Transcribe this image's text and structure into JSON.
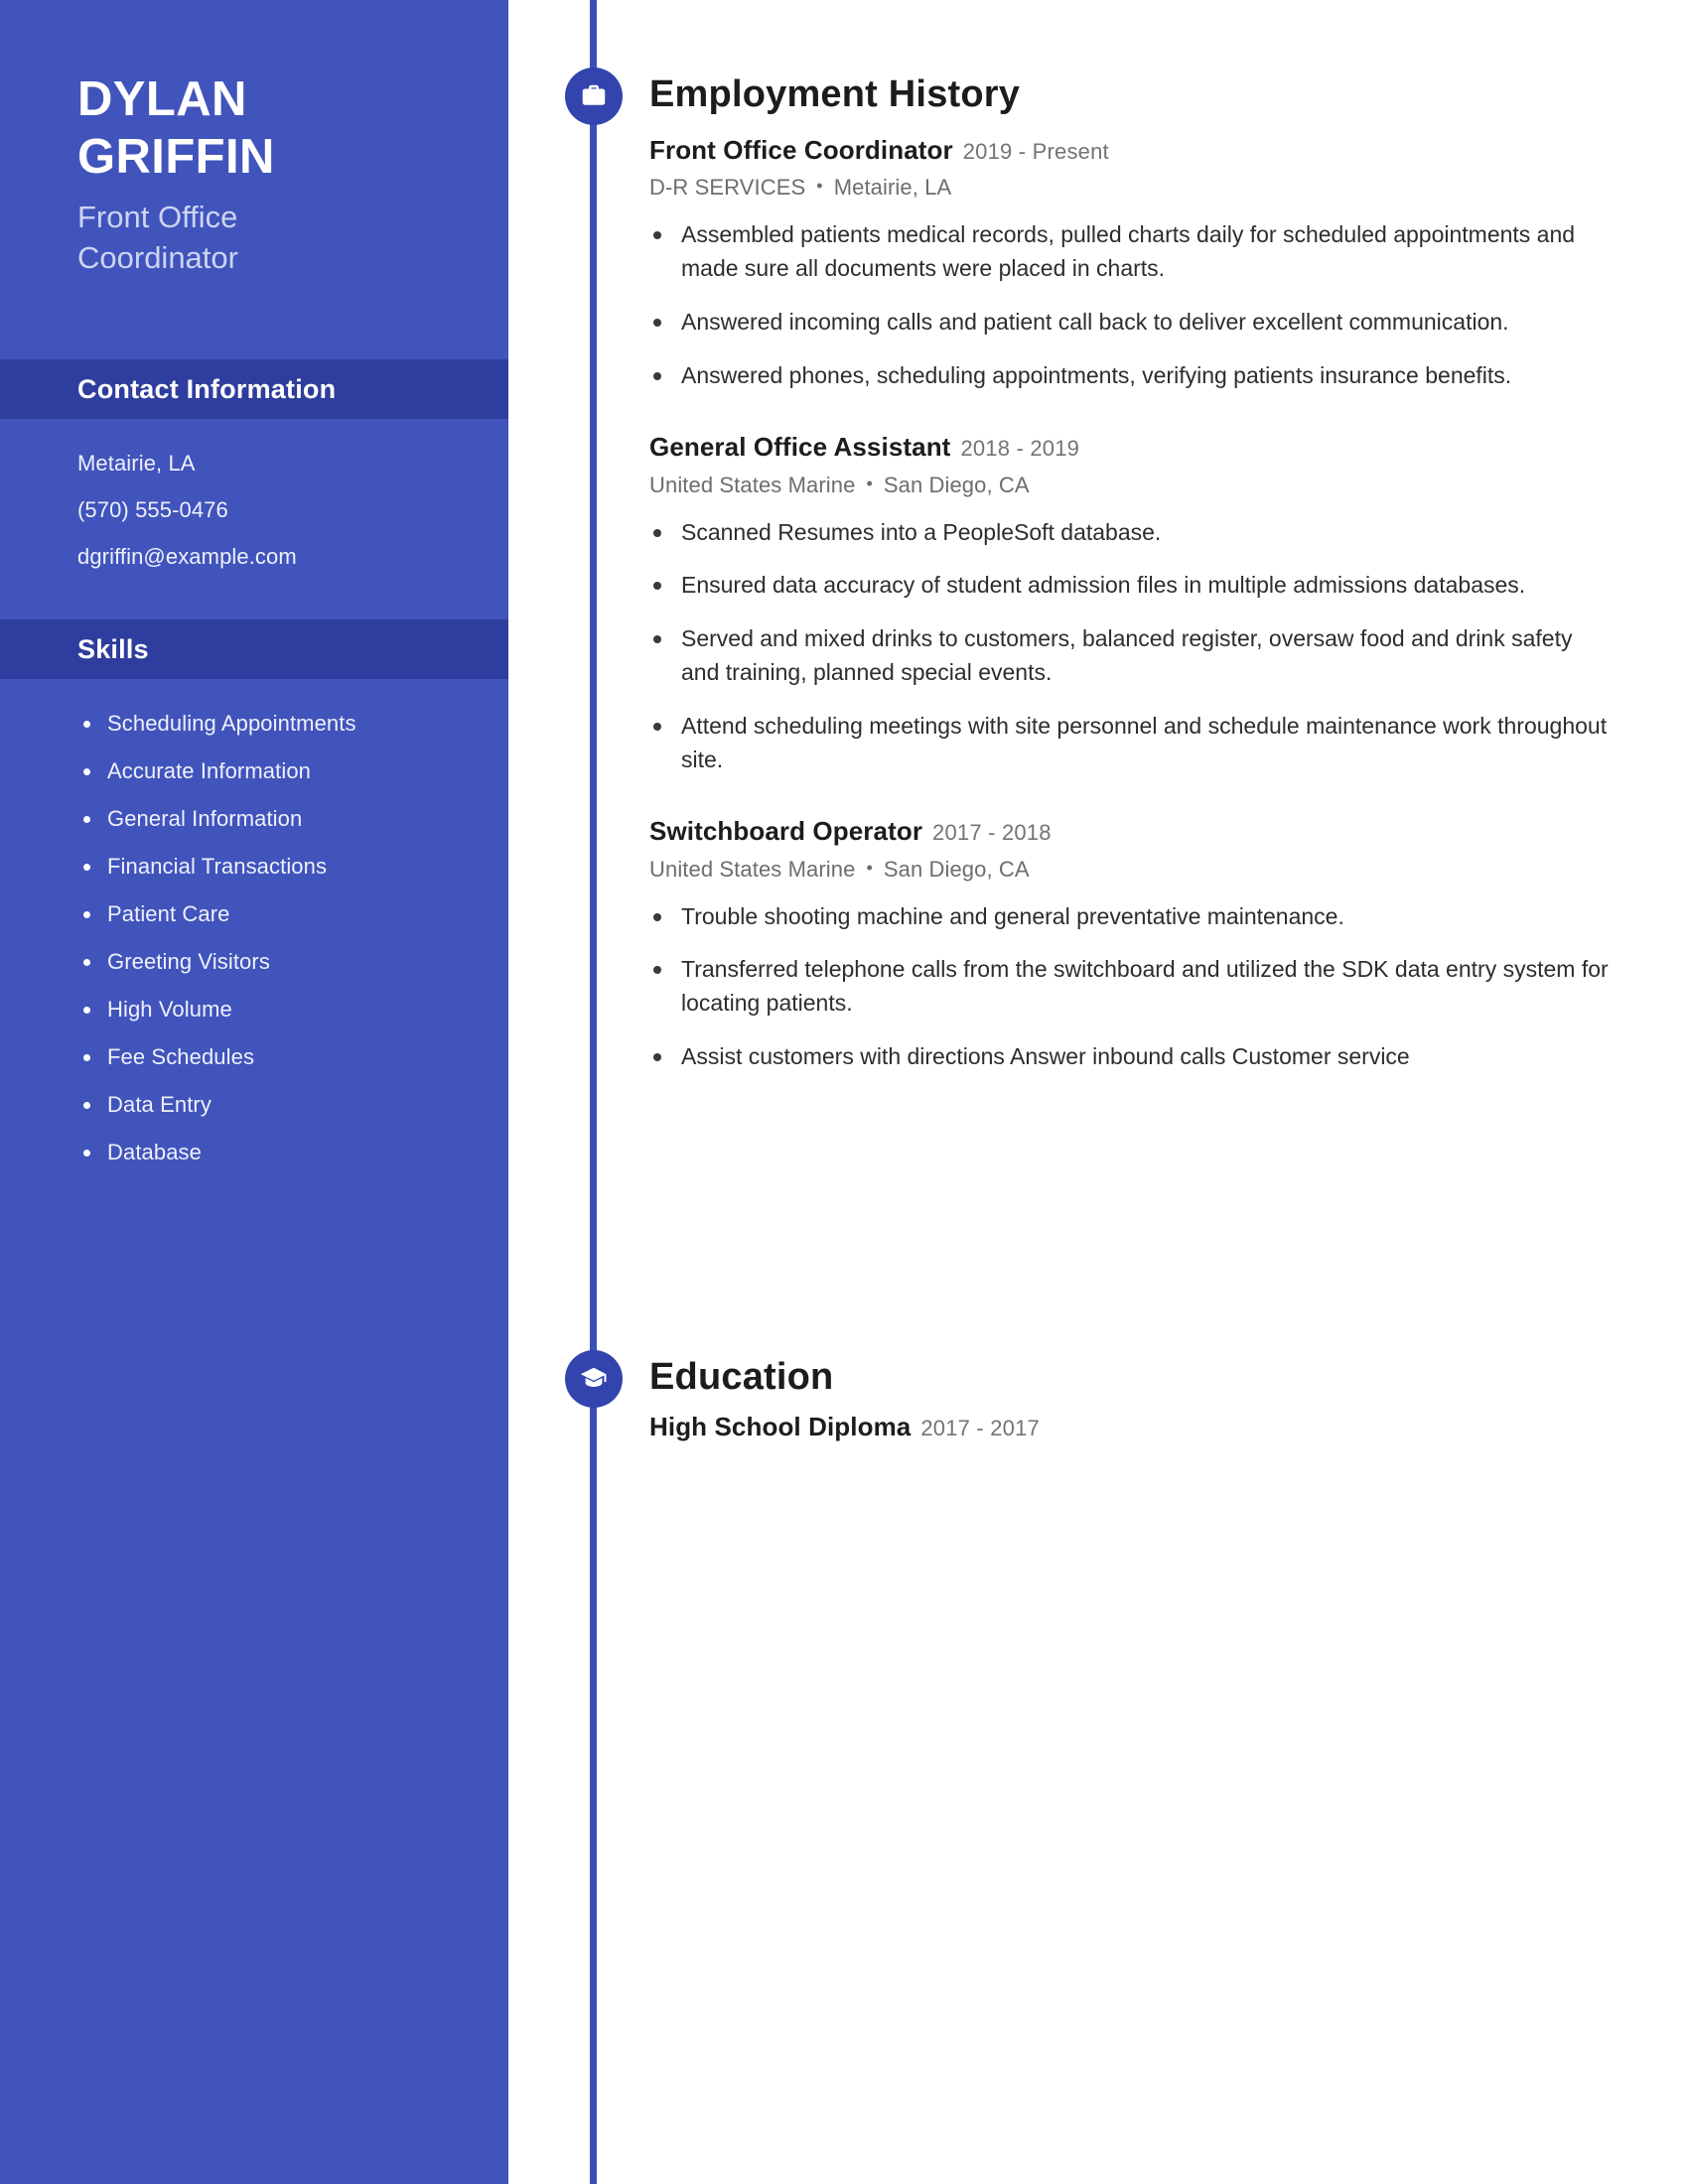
{
  "theme": {
    "sidebar_bg": "#4154bc",
    "sidebar_head_bg": "#2f3d9e",
    "accent": "#3344ae",
    "rail": "#3c4fb8",
    "text_dark": "#1c1c1c",
    "text_muted": "#6d6d6d",
    "sidebar_text": "#eef1fb"
  },
  "sidebar": {
    "name_first": "DYLAN",
    "name_last": "GRIFFIN",
    "job_title_line1": "Front Office",
    "job_title_line2": "Coordinator",
    "contact": {
      "heading": "Contact Information",
      "items": [
        "Metairie, LA",
        "(570) 555-0476",
        "dgriffin@example.com"
      ]
    },
    "skills": {
      "heading": "Skills",
      "items": [
        "Scheduling Appointments",
        "Accurate Information",
        "General Information",
        "Financial Transactions",
        "Patient Care",
        "Greeting Visitors",
        "High Volume",
        "Fee Schedules",
        "Data Entry",
        "Database"
      ]
    }
  },
  "main": {
    "employment": {
      "icon": "briefcase-icon",
      "heading": "Employment History",
      "entries": [
        {
          "role": "Front Office Coordinator",
          "dates": "2019 - Present",
          "company": "D-R SERVICES",
          "location": "Metairie, LA",
          "separator": "•",
          "bullets": [
            "Assembled patients medical records, pulled charts daily for scheduled appointments and made sure all documents were placed in charts.",
            "Answered incoming calls and patient call back to deliver excellent communication.",
            "Answered phones, scheduling appointments, verifying patients insurance benefits."
          ]
        },
        {
          "role": "General Office Assistant",
          "dates": "2018 - 2019",
          "company": "United States Marine",
          "location": "San Diego, CA",
          "separator": "•",
          "bullets": [
            "Scanned Resumes into a PeopleSoft database.",
            "Ensured data accuracy of student admission files in multiple admissions databases.",
            "Served and mixed drinks to customers, balanced register, oversaw food and drink safety and training, planned special events.",
            "Attend scheduling meetings with site personnel and schedule maintenance work throughout site."
          ]
        },
        {
          "role": "Switchboard Operator",
          "dates": "2017 - 2018",
          "company": "United States Marine",
          "location": "San Diego, CA",
          "separator": "•",
          "bullets": [
            "Trouble shooting machine and general preventative maintenance.",
            "Transferred telephone calls from the switchboard and utilized the SDK data entry system for locating patients.",
            "Assist customers with directions Answer inbound calls Customer service"
          ]
        }
      ]
    },
    "education": {
      "icon": "graduation-cap-icon",
      "heading": "Education",
      "entries": [
        {
          "degree": "High School Diploma",
          "dates": "2017 - 2017"
        }
      ]
    }
  }
}
